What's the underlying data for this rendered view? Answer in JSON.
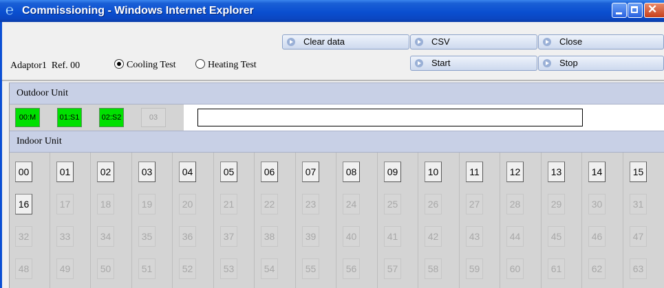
{
  "window": {
    "title": "Commissioning - Windows Internet Explorer"
  },
  "toolbar": {
    "clear_data": "Clear data",
    "csv": "CSV",
    "close": "Close",
    "start": "Start",
    "stop": "Stop"
  },
  "adaptor": {
    "label": "Adaptor1  Ref. 00"
  },
  "test_mode": {
    "cooling": "Cooling Test",
    "heating": "Heating Test",
    "selected": "Cooling Test"
  },
  "outdoor": {
    "header": "Outdoor Unit",
    "units": [
      {
        "label": "00:M",
        "active": true
      },
      {
        "label": "01:S1",
        "active": true
      },
      {
        "label": "02:S2",
        "active": true
      },
      {
        "label": "03",
        "active": false
      }
    ],
    "status_text": ""
  },
  "indoor": {
    "header": "Indoor Unit",
    "units": [
      "00",
      "01",
      "02",
      "03",
      "04",
      "05",
      "06",
      "07",
      "08",
      "09",
      "10",
      "11",
      "12",
      "13",
      "14",
      "15",
      "16",
      "17",
      "18",
      "19",
      "20",
      "21",
      "22",
      "23",
      "24",
      "25",
      "26",
      "27",
      "28",
      "29",
      "30",
      "31",
      "32",
      "33",
      "34",
      "35",
      "36",
      "37",
      "38",
      "39",
      "40",
      "41",
      "42",
      "43",
      "44",
      "45",
      "46",
      "47",
      "48",
      "49",
      "50",
      "51",
      "52",
      "53",
      "54",
      "55",
      "56",
      "57",
      "58",
      "59",
      "60",
      "61",
      "62",
      "63"
    ],
    "active_count": 17
  },
  "colors": {
    "active_unit": "#00e000",
    "header_band": "#c8d0e6",
    "title_bar": "#0a4fd0"
  },
  "icons": [
    "ie-logo-icon",
    "minimize-icon",
    "maximize-icon",
    "close-icon",
    "play-arrow-icon"
  ]
}
